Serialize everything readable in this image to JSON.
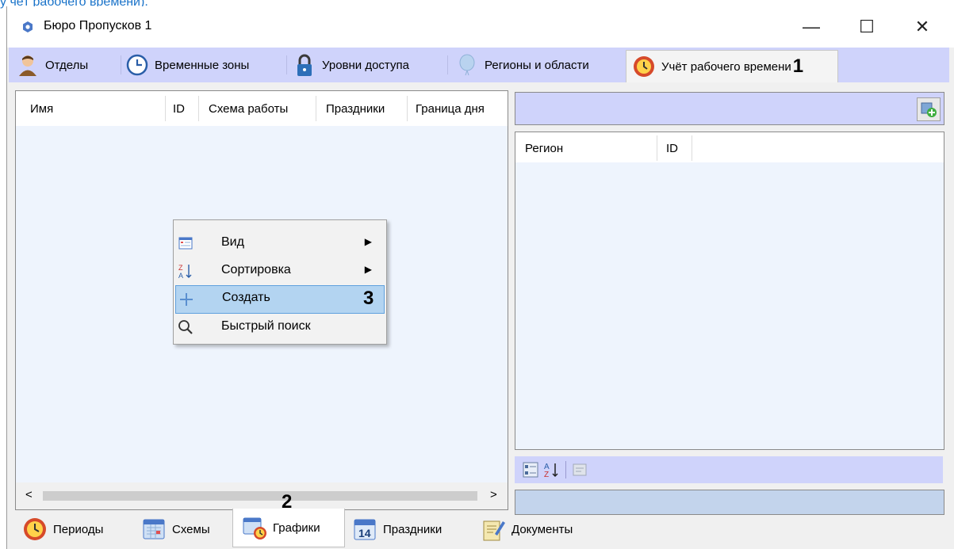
{
  "top_link": "у чёт рабочего времени).",
  "window": {
    "title": "Бюро Пропусков 1",
    "controls": {
      "minimize": "—",
      "maximize": "☐",
      "close": "✕"
    }
  },
  "top_tabs": [
    {
      "label": "Отделы",
      "icon": "person-icon"
    },
    {
      "label": "Временные зоны",
      "icon": "clock-icon"
    },
    {
      "label": "Уровни доступа",
      "icon": "lock-icon"
    },
    {
      "label": "Регионы и области",
      "icon": "balloon-icon"
    },
    {
      "label": "Учёт рабочего времени",
      "icon": "time-accounting-icon",
      "active": true
    }
  ],
  "callouts": {
    "one": "1",
    "two": "2",
    "three": "3"
  },
  "left_grid": {
    "columns": [
      "Имя",
      "ID",
      "Схема работы",
      "Праздники",
      "Граница дня"
    ]
  },
  "right_grid": {
    "columns": [
      "Регион",
      "ID"
    ]
  },
  "context_menu": {
    "items": [
      {
        "label": "Вид",
        "icon": "view-icon",
        "submenu": true
      },
      {
        "label": "Сортировка",
        "icon": "sort-az-icon",
        "submenu": true
      },
      {
        "label": "Создать",
        "icon": "plus-icon",
        "submenu": false,
        "highlighted": true
      },
      {
        "label": "Быстрый поиск",
        "icon": "magnifier-icon",
        "submenu": false
      }
    ]
  },
  "scroll": {
    "left": "<",
    "right": ">"
  },
  "bottom_tabs": [
    {
      "label": "Периоды",
      "icon": "periods-icon"
    },
    {
      "label": "Схемы",
      "icon": "schemes-icon"
    },
    {
      "label": "Графики",
      "icon": "schedules-icon",
      "active": true
    },
    {
      "label": "Праздники",
      "icon": "calendar-14-icon"
    },
    {
      "label": "Документы",
      "icon": "documents-icon"
    }
  ],
  "colors": {
    "accent_bar": "#cfd3fb",
    "grid_bg": "#eef4fd",
    "menu_highlight": "#b3d4f1"
  }
}
